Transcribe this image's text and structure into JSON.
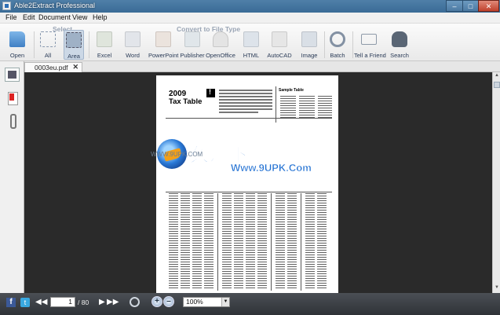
{
  "window": {
    "title": "Able2Extract Professional"
  },
  "menu": [
    "File",
    "Edit",
    "Document",
    "View",
    "Help"
  ],
  "toolbar": {
    "select_group_label": "Select",
    "convert_group_label": "Convert to File Type",
    "open": "Open",
    "all": "All",
    "area": "Area",
    "excel": "Excel",
    "word": "Word",
    "powerpoint": "PowerPoint",
    "publisher": "Publisher",
    "openoffice": "OpenOffice",
    "html": "HTML",
    "autocad": "AutoCAD",
    "image": "Image",
    "batch": "Batch",
    "tell_friend": "Tell a Friend",
    "search": "Search"
  },
  "tabs": [
    {
      "label": "0003eu.pdf"
    }
  ],
  "document": {
    "year": "2009",
    "title": "Tax Table",
    "sample_label": "Sample Table"
  },
  "watermark": {
    "cn_text": "久友下载站",
    "url": "Www.9UPK.Com",
    "small_text": "WWW.9UPK.COM"
  },
  "status": {
    "page_current": "1",
    "page_total": "/ 80",
    "zoom": "100%"
  },
  "colors": {
    "titlebar": "#3a6b96",
    "viewer_bg": "#2a2a2a",
    "statusbar": "#2f3237",
    "watermark_blue": "#1f6fd2"
  }
}
